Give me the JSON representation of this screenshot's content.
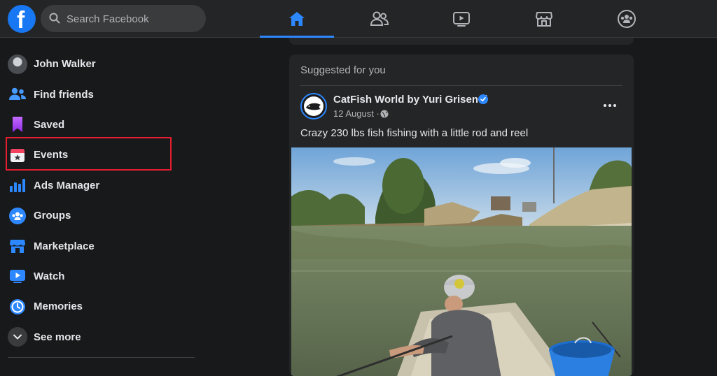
{
  "header": {
    "search_placeholder": "Search Facebook",
    "logo_letter": "f",
    "nav_tabs": [
      {
        "name": "home",
        "icon": "home-icon",
        "active": true
      },
      {
        "name": "friends",
        "icon": "friends-icon",
        "active": false
      },
      {
        "name": "watch",
        "icon": "watch-icon",
        "active": false
      },
      {
        "name": "marketplace",
        "icon": "marketplace-icon",
        "active": false
      },
      {
        "name": "groups",
        "icon": "groups-icon",
        "active": false
      }
    ]
  },
  "sidebar": {
    "items": [
      {
        "label": "John Walker",
        "icon": "avatar"
      },
      {
        "label": "Find friends",
        "icon": "friends-icon"
      },
      {
        "label": "Saved",
        "icon": "bookmark-icon"
      },
      {
        "label": "Events",
        "icon": "calendar-star-icon"
      },
      {
        "label": "Ads Manager",
        "icon": "bar-chart-icon"
      },
      {
        "label": "Groups",
        "icon": "groups-icon"
      },
      {
        "label": "Marketplace",
        "icon": "marketplace-icon"
      },
      {
        "label": "Watch",
        "icon": "watch-icon"
      },
      {
        "label": "Memories",
        "icon": "clock-icon"
      },
      {
        "label": "See more",
        "icon": "chevron-down-icon"
      }
    ],
    "highlighted_item": "Events"
  },
  "feed": {
    "suggested_label": "Suggested for you",
    "post": {
      "page_name": "CatFish World by Yuri Grisendi",
      "verified": true,
      "date": "12 August · ",
      "text": "Crazy 230 lbs fish fishing with a little rod and reel",
      "media": "photo of a man fishing from a boat on a river"
    }
  },
  "colors": {
    "background": "#18191a",
    "surface": "#242526",
    "accent": "#2d88ff",
    "highlight_box": "#e41e2f",
    "text_primary": "#e4e6eb",
    "text_secondary": "#b0b3b8"
  }
}
